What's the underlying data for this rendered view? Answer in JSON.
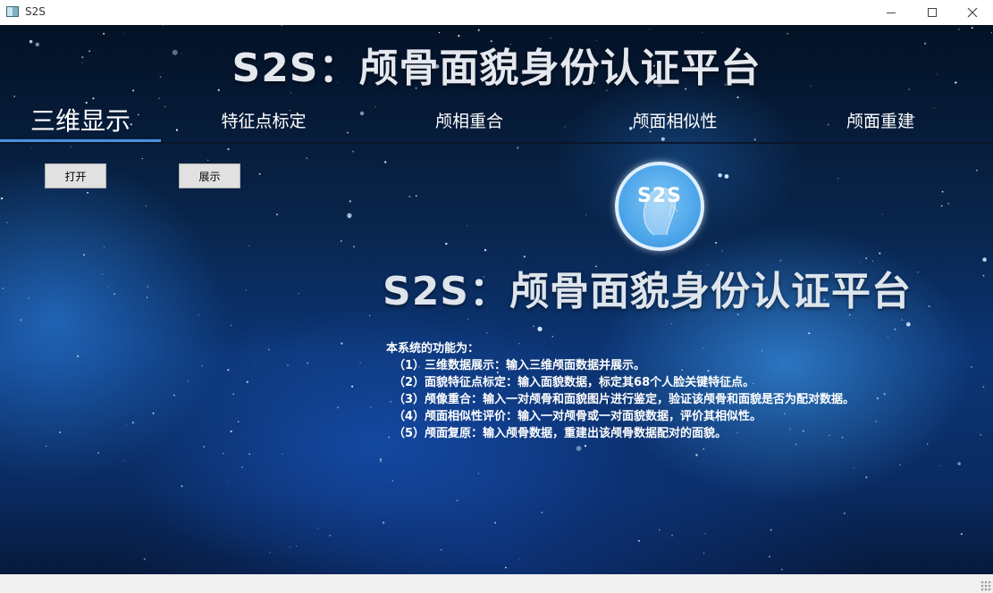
{
  "window": {
    "title": "S2S",
    "icons": {
      "app": "app-window-icon",
      "minimize": "minimize-icon",
      "maximize": "maximize-icon",
      "close": "close-icon"
    }
  },
  "header": {
    "title": "S2S：颅骨面貌身份认证平台"
  },
  "tabs": [
    {
      "label": "三维显示",
      "active": true
    },
    {
      "label": "特征点标定",
      "active": false
    },
    {
      "label": "颅相重合",
      "active": false
    },
    {
      "label": "颅面相似性",
      "active": false
    },
    {
      "label": "颅面重建",
      "active": false
    }
  ],
  "toolbar": {
    "open_label": "打开",
    "show_label": "展示"
  },
  "hero": {
    "logo_text": "S2S",
    "title": "S2S：颅骨面貌身份认证平台",
    "description": {
      "heading": "本系统的功能为：",
      "items": [
        "（1）三维数据展示：输入三维颅面数据并展示。",
        "（2）面貌特征点标定：输入面貌数据，标定其68个人脸关键特征点。",
        "（3）颅像重合：输入一对颅骨和面貌图片进行鉴定，验证该颅骨和面貌是否为配对数据。",
        "（4）颅面相似性评价：输入一对颅骨或一对面貌数据，评价其相似性。",
        "（5）颅面复原：输入颅骨数据，重建出该颅骨数据配对的面貌。"
      ]
    }
  },
  "colors": {
    "tab_underline": "#4a8fe0",
    "background_top": "#041226",
    "background_mid": "#0c3575",
    "logo_fill": "#4ea7ea"
  }
}
